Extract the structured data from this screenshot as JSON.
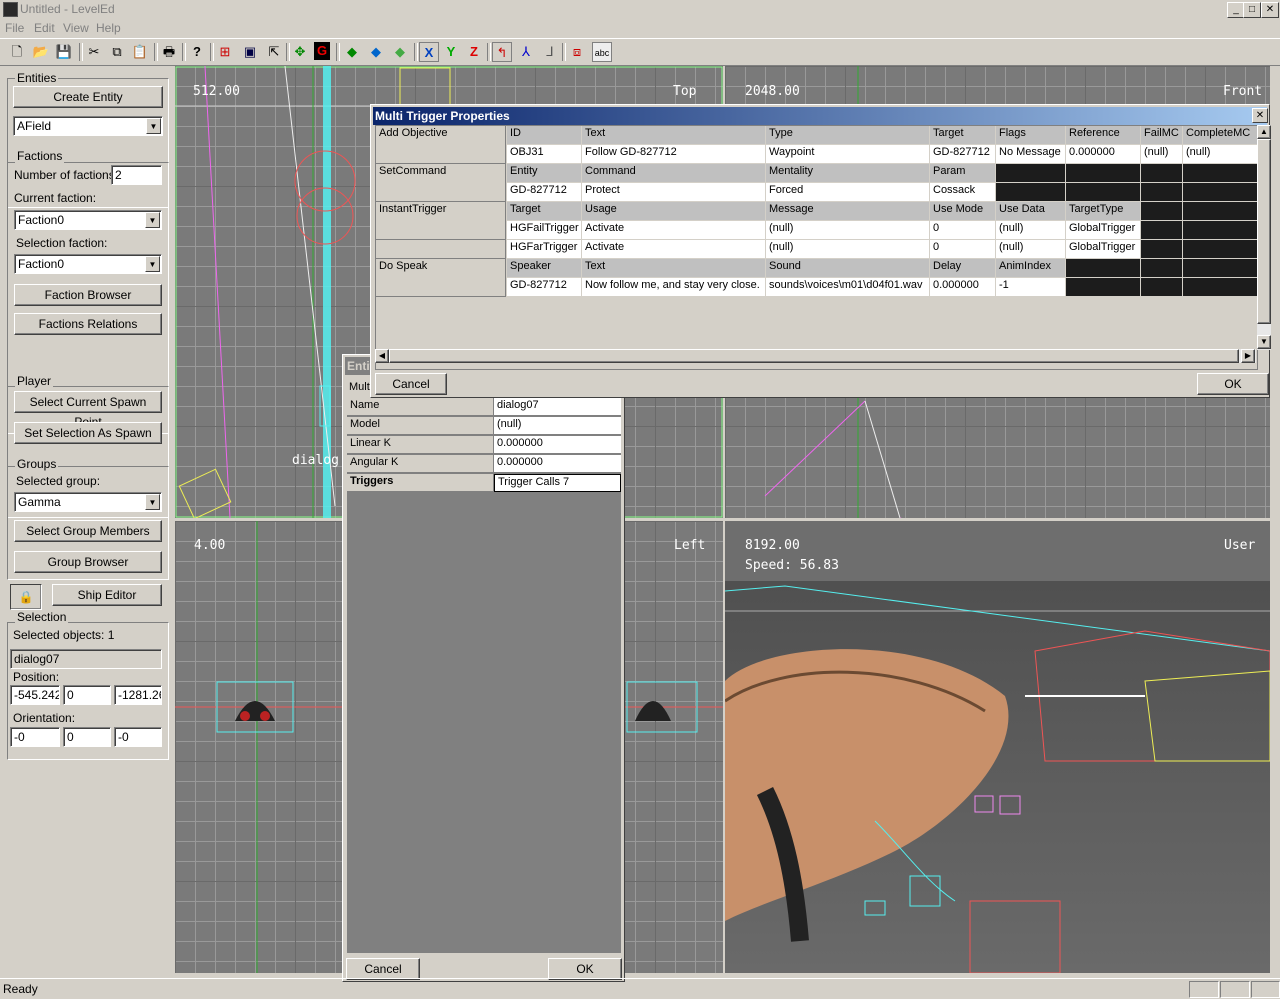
{
  "window": {
    "title": "Untitled - LevelEd",
    "minimize": "_",
    "maximize": "□",
    "close": "✕"
  },
  "menu": [
    "File",
    "Edit",
    "View",
    "Help"
  ],
  "toolbar_icons": [
    "new-icon",
    "open-icon",
    "save-icon",
    "cut-icon",
    "copy-icon",
    "paste-icon",
    "print-icon",
    "help-icon",
    "grid-icon",
    "frame-icon",
    "cursor-icon",
    "move-icon",
    "g-icon",
    "diamond-green-icon",
    "diamond-blue-icon",
    "diamond-multi-icon",
    "x-axis-icon",
    "y-axis-icon",
    "z-axis-icon",
    "axis-red-icon",
    "axis-blue-icon",
    "axis-gray-icon",
    "shapes-icon",
    "text-icon"
  ],
  "entities": {
    "label": "Entities",
    "create_button": "Create Entity",
    "entity_type": "AField"
  },
  "factions": {
    "label": "Factions",
    "number_label": "Number of factions:",
    "number_value": "2",
    "current_label": "Current faction:",
    "current_value": "Faction0",
    "selection_label": "Selection faction:",
    "selection_value": "Faction0",
    "browser_button": "Faction Browser",
    "relations_button": "Factions Relations"
  },
  "player": {
    "label": "Player",
    "spawn_button": "Select Current Spawn Point",
    "set_spawn_button": "Set Selection As Spawn"
  },
  "groups": {
    "label": "Groups",
    "selected_label": "Selected group:",
    "selected_value": "Gamma",
    "members_button": "Select Group Members",
    "browser_button": "Group Browser"
  },
  "ship_editor_button": "Ship Editor",
  "selection": {
    "label": "Selection",
    "count": "Selected objects: 1",
    "name": "dialog07",
    "position_label": "Position:",
    "position": [
      "-545.242",
      "0",
      "-1281.26"
    ],
    "orientation_label": "Orientation:",
    "orientation": [
      "-0",
      "0",
      "-0"
    ]
  },
  "viewports": {
    "top": {
      "scale": "512.00",
      "name": "Top"
    },
    "front": {
      "scale": "2048.00",
      "name": "Front"
    },
    "left": {
      "scale": "4.00",
      "name": "Left"
    },
    "user": {
      "scale": "8192.00",
      "speed": "Speed: 56.83",
      "name": "User"
    },
    "object_label": "dialog"
  },
  "multi_trigger": {
    "title": "Multi Trigger Properties",
    "rows": [
      {
        "head": "Add Objective",
        "cells": [
          "ID",
          "Text",
          "Type",
          "Target",
          "Flags",
          "Reference",
          "FailMC",
          "CompleteMC"
        ],
        "style": "g"
      },
      {
        "head": "",
        "cells": [
          "OBJ31",
          "Follow GD-827712",
          "Waypoint",
          "GD-827712",
          "No Message",
          "0.000000",
          "(null)",
          "(null)"
        ],
        "style": "w"
      },
      {
        "head": "SetCommand",
        "cells": [
          "Entity",
          "Command",
          "Mentality",
          "Param",
          "",
          "",
          "",
          ""
        ],
        "style": "g"
      },
      {
        "head": "",
        "cells": [
          "GD-827712",
          "Protect",
          "Forced",
          "Cossack",
          "",
          "",
          "",
          ""
        ],
        "style": "w"
      },
      {
        "head": "InstantTrigger",
        "cells": [
          "Target",
          "Usage",
          "Message",
          "Use Mode",
          "Use Data",
          "TargetType",
          "",
          ""
        ],
        "style": "g"
      },
      {
        "head": "",
        "cells": [
          "HGFailTrigger",
          "Activate",
          "(null)",
          "0",
          "(null)",
          "GlobalTrigger",
          "",
          ""
        ],
        "style": "w"
      },
      {
        "head": "",
        "cells": [
          "HGFarTrigger",
          "Activate",
          "(null)",
          "0",
          "(null)",
          "GlobalTrigger",
          "",
          ""
        ],
        "style": "w"
      },
      {
        "head": "Do Speak",
        "cells": [
          "Speaker",
          "Text",
          "Sound",
          "Delay",
          "AnimIndex",
          "",
          "",
          ""
        ],
        "style": "g"
      },
      {
        "head": "",
        "cells": [
          "GD-827712",
          "Now follow me, and stay very close.",
          "sounds\\voices\\m01\\d04f01.wav",
          "0.000000",
          "-1",
          "",
          "",
          ""
        ],
        "style": "w"
      }
    ],
    "cancel": "Cancel",
    "ok": "OK"
  },
  "entity_dialog": {
    "title": "Entit",
    "tab": "Mult",
    "props": [
      {
        "name": "Name",
        "value": "dialog07"
      },
      {
        "name": "Model",
        "value": "(null)"
      },
      {
        "name": "Linear K",
        "value": "0.000000"
      },
      {
        "name": "Angular K",
        "value": "0.000000"
      },
      {
        "name": "Triggers",
        "value": "Trigger Calls 7"
      }
    ],
    "cancel": "Cancel",
    "ok": "OK"
  },
  "status": "Ready"
}
